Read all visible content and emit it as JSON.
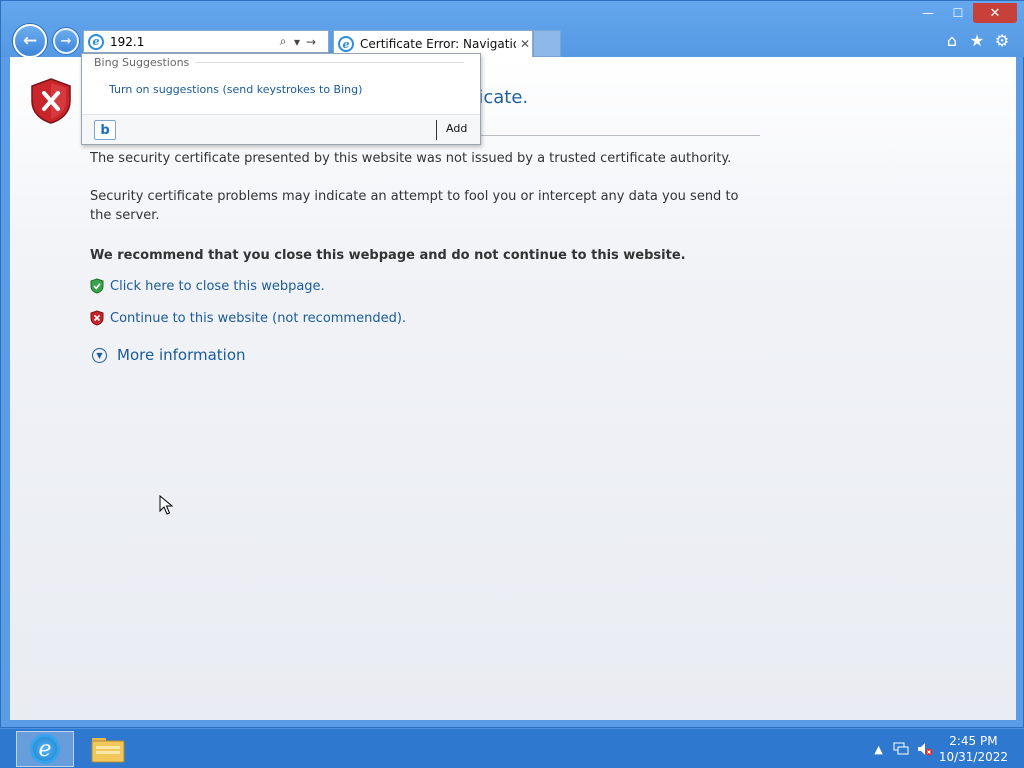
{
  "window": {
    "minimize_label": "—",
    "maximize_label": "☐",
    "close_label": "✕"
  },
  "toolbar": {
    "back_label": "←",
    "forward_label": "→",
    "address_value": "192.1",
    "search_icon": "⌕",
    "dropdown_icon": "▾",
    "go_icon": "→",
    "home_icon": "⌂",
    "favorites_icon": "★",
    "tools_icon": "⚙"
  },
  "tab": {
    "title": "Certificate Error: Navigation...",
    "close_label": "✕"
  },
  "page": {
    "heading_fragment": "ficate.",
    "p1": "The security certificate presented by this website was not issued by a trusted certificate authority.",
    "p2": "Security certificate problems may indicate an attempt to fool you or intercept any data you send to the server.",
    "p3": "We recommend that you close this webpage and do not continue to this website.",
    "close_link": "Click here to close this webpage.",
    "continue_link": "Continue to this website (not recommended).",
    "more_info": "More information",
    "more_info_icon": "▼"
  },
  "suggestions": {
    "header": "Bing Suggestions",
    "turn_on_link": "Turn on suggestions (send keystrokes to Bing)",
    "bing_letter": "b",
    "add_label": "Add"
  },
  "taskbar": {
    "ie_letter": "e",
    "tray_arrow": "▲",
    "time": "2:45 PM",
    "date": "10/31/2022"
  },
  "colors": {
    "link": "#1a5b99",
    "frame": "#5a9ce6",
    "taskbar": "#2f78cf",
    "error_red": "#c7413a"
  }
}
